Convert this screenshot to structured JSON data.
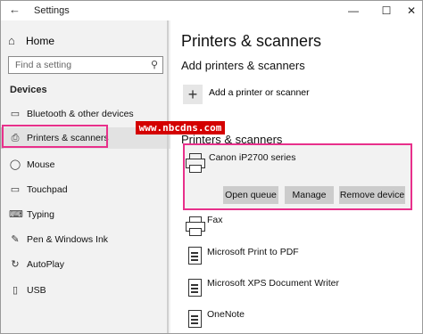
{
  "titlebar": {
    "title": "Settings",
    "back_glyph": "←",
    "minimize_glyph": "—",
    "maximize_glyph": "☐",
    "close_glyph": "✕"
  },
  "sidebar": {
    "home_label": "Home",
    "home_icon": "home-icon",
    "search_placeholder": "Find a setting",
    "section_title": "Devices",
    "items": [
      {
        "label": "Bluetooth & other devices",
        "icon": "bluetooth-icon",
        "glyph": "▭"
      },
      {
        "label": "Printers & scanners",
        "icon": "printer-icon",
        "glyph": "⎙",
        "active": true
      },
      {
        "label": "Mouse",
        "icon": "mouse-icon",
        "glyph": "◯"
      },
      {
        "label": "Touchpad",
        "icon": "touchpad-icon",
        "glyph": "▭"
      },
      {
        "label": "Typing",
        "icon": "keyboard-icon",
        "glyph": "⌨"
      },
      {
        "label": "Pen & Windows Ink",
        "icon": "pen-icon",
        "glyph": "✎"
      },
      {
        "label": "AutoPlay",
        "icon": "autoplay-icon",
        "glyph": "↻"
      },
      {
        "label": "USB",
        "icon": "usb-icon",
        "glyph": "▯"
      }
    ]
  },
  "main": {
    "page_title": "Printers & scanners",
    "add_section_title": "Add printers & scanners",
    "add_button_glyph": "+",
    "add_label": "Add a printer or scanner",
    "list_section_title": "Printers & scanners",
    "watermark": "www.nbcdns.com",
    "printers": [
      {
        "name": "Canon iP2700 series",
        "icon": "printer-icon",
        "selected": true
      },
      {
        "name": "Fax",
        "icon": "printer-icon"
      },
      {
        "name": "Microsoft Print to PDF",
        "icon": "document-printer-icon"
      },
      {
        "name": "Microsoft XPS Document Writer",
        "icon": "document-printer-icon"
      },
      {
        "name": "OneNote",
        "icon": "document-printer-icon"
      }
    ],
    "actions": {
      "open_queue": "Open queue",
      "manage": "Manage",
      "remove_device": "Remove device"
    }
  },
  "colors": {
    "highlight": "#e8308b",
    "watermark_bg": "#d40000",
    "sidebar_bg": "#f2f2f2",
    "button_bg": "#cccccc"
  }
}
